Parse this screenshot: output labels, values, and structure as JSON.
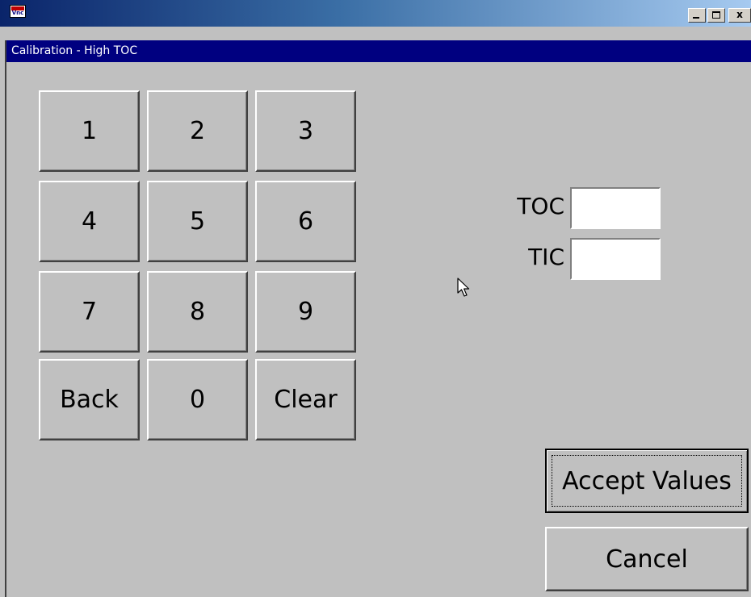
{
  "window": {
    "app_icon": "vnc-icon",
    "app_icon_text": "Vnc",
    "controls": {
      "minimize": "_",
      "maximize": "□",
      "close": "x"
    }
  },
  "dialog": {
    "title": "Calibration - High TOC"
  },
  "keypad": {
    "keys": [
      "1",
      "2",
      "3",
      "4",
      "5",
      "6",
      "7",
      "8",
      "9",
      "Back",
      "0",
      "Clear"
    ]
  },
  "fields": {
    "toc": {
      "label": "TOC",
      "value": ""
    },
    "tic": {
      "label": "TIC",
      "value": ""
    }
  },
  "actions": {
    "accept_label": "Accept Values",
    "cancel_label": "Cancel"
  },
  "colors": {
    "title_bar": "#000080",
    "face": "#c0c0c0"
  }
}
